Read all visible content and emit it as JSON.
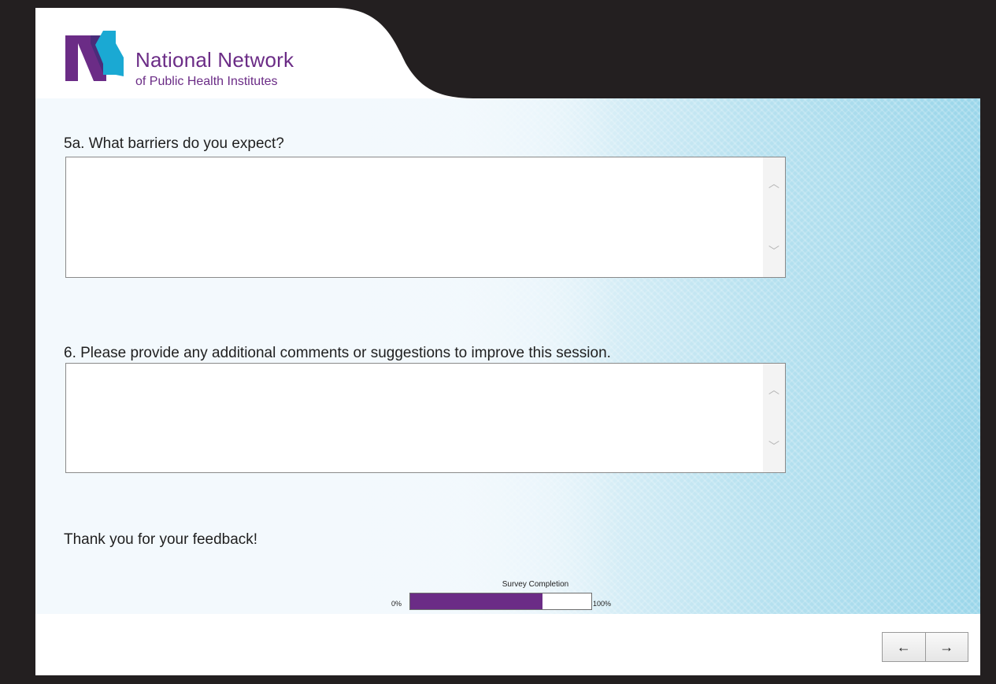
{
  "colors": {
    "frame_bg": "#231f20",
    "brand_purple": "#6b2c86",
    "brand_teal": "#1aa9d3",
    "progress_fill": "#6b2c86"
  },
  "logo": {
    "line1": "National Network",
    "line2": "of Public Health Institutes",
    "icon": "nnphi-logo-icon"
  },
  "questions": [
    {
      "label": "5a. What barriers do you expect?",
      "value": "",
      "placeholder": ""
    },
    {
      "label": "6. Please provide any additional comments or suggestions to improve this session.",
      "value": "",
      "placeholder": ""
    }
  ],
  "thanks": "Thank you for your feedback!",
  "progress": {
    "title": "Survey Completion",
    "min_label": "0%",
    "max_label": "100%",
    "fraction": 0.73
  },
  "nav": {
    "back_label": "←",
    "next_label": "→"
  }
}
